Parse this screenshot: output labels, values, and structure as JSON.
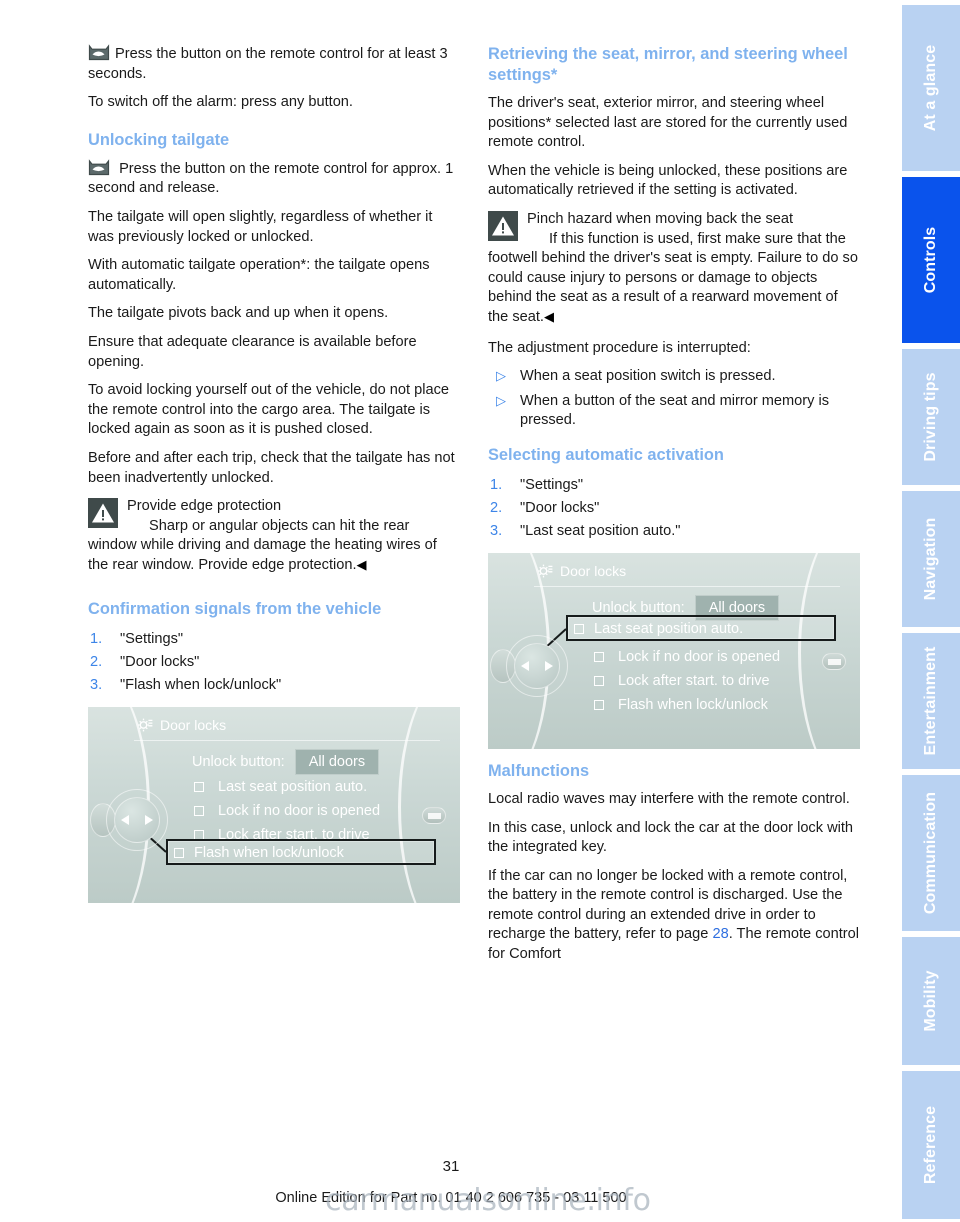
{
  "page": {
    "number": "31",
    "footer": "Online Edition for Part no. 01 40 2 606 735 - 03 11 500",
    "watermark": "carmanualsonline.info"
  },
  "tabs": [
    {
      "label": "At a glance",
      "active": false
    },
    {
      "label": "Controls",
      "active": true
    },
    {
      "label": "Driving tips",
      "active": false
    },
    {
      "label": "Navigation",
      "active": false
    },
    {
      "label": "Entertainment",
      "active": false
    },
    {
      "label": "Communication",
      "active": false
    },
    {
      "label": "Mobility",
      "active": false
    },
    {
      "label": "Reference",
      "active": false
    }
  ],
  "colors": {
    "heading_blue": "#7fb2ee",
    "accent_blue": "#3d85e8",
    "tab_inactive": "#b9d2f2",
    "tab_active": "#0a53ec",
    "warn_icon_bg": "#3f4a4a"
  },
  "left_column": {
    "p_press_3s": "Press the button on the remote control for at least 3 seconds.",
    "p_switch_off": "To switch off the alarm: press any button.",
    "h_unlocking_tailgate": "Unlocking tailgate",
    "p_press_1s": "Press the button on the remote control for approx. 1 second and release.",
    "p_open_slightly": "The tailgate will open slightly, regardless of whether it was previously locked or unlocked.",
    "p_automatic": "With automatic tailgate operation*: the tailgate opens automatically.",
    "p_pivots": "The tailgate pivots back and up when it opens.",
    "p_clearance": "Ensure that adequate clearance is available before opening.",
    "p_avoid_locking": "To avoid locking yourself out of the vehicle, do not place the remote control into the cargo area. The tailgate is locked again as soon as it is pushed closed.",
    "p_before_after": "Before and after each trip, check that the tailgate has not been inadvertently unlocked.",
    "warn_title": "Provide edge protection",
    "warn_body": "Sharp or angular objects can hit the rear window while driving and damage the heating wires of the rear window. Provide edge protection.",
    "warn_end": "◀",
    "h_confirmation": "Confirmation signals from the vehicle",
    "steps": [
      {
        "num": "1.",
        "text": "\"Settings\""
      },
      {
        "num": "2.",
        "text": "\"Door locks\""
      },
      {
        "num": "3.",
        "text": "\"Flash when lock/unlock\""
      }
    ]
  },
  "right_column": {
    "h_retrieving": "Retrieving the seat, mirror, and steering wheel settings*",
    "p_drivers_seat": "The driver's seat, exterior mirror, and steering wheel positions* selected last are stored for the currently used remote control.",
    "p_unlocked": "When the vehicle is being unlocked, these positions are automatically retrieved if the setting is activated.",
    "warn_title": "Pinch hazard when moving back the seat",
    "warn_body": "If this function is used, first make sure that the footwell behind the driver's seat is empty. Failure to do so could cause injury to persons or damage to objects behind the seat as a result of a rearward movement of the seat.",
    "warn_end": "◀",
    "p_interrupted": "The adjustment procedure is interrupted:",
    "bullets": [
      "When a seat position switch is pressed.",
      "When a button of the seat and mirror memory is pressed."
    ],
    "h_selecting": "Selecting automatic activation",
    "steps": [
      {
        "num": "1.",
        "text": "\"Settings\""
      },
      {
        "num": "2.",
        "text": "\"Door locks\""
      },
      {
        "num": "3.",
        "text": "\"Last seat position auto.\""
      }
    ],
    "h_malfunctions": "Malfunctions",
    "p_radio_waves": "Local radio waves may interfere with the remote control.",
    "p_in_this_case": "In this case, unlock and lock the car at the door lock with the integrated key.",
    "p_battery_1": "If the car can no longer be locked with a remote control, the battery in the remote control is discharged. Use the remote control during an extended drive in order to recharge the battery, refer to page ",
    "p_battery_link": "28",
    "p_battery_2": ". The remote control for Comfort"
  },
  "idrive_screen": {
    "title": "Door locks",
    "unlock_label": "Unlock button:",
    "unlock_value": "All doors",
    "options": [
      "Last seat position auto.",
      "Lock if no door is opened",
      "Lock after start. to drive",
      "Flash when lock/unlock"
    ],
    "highlight_left": "Flash when lock/unlock",
    "highlight_right": "Last seat position auto."
  }
}
